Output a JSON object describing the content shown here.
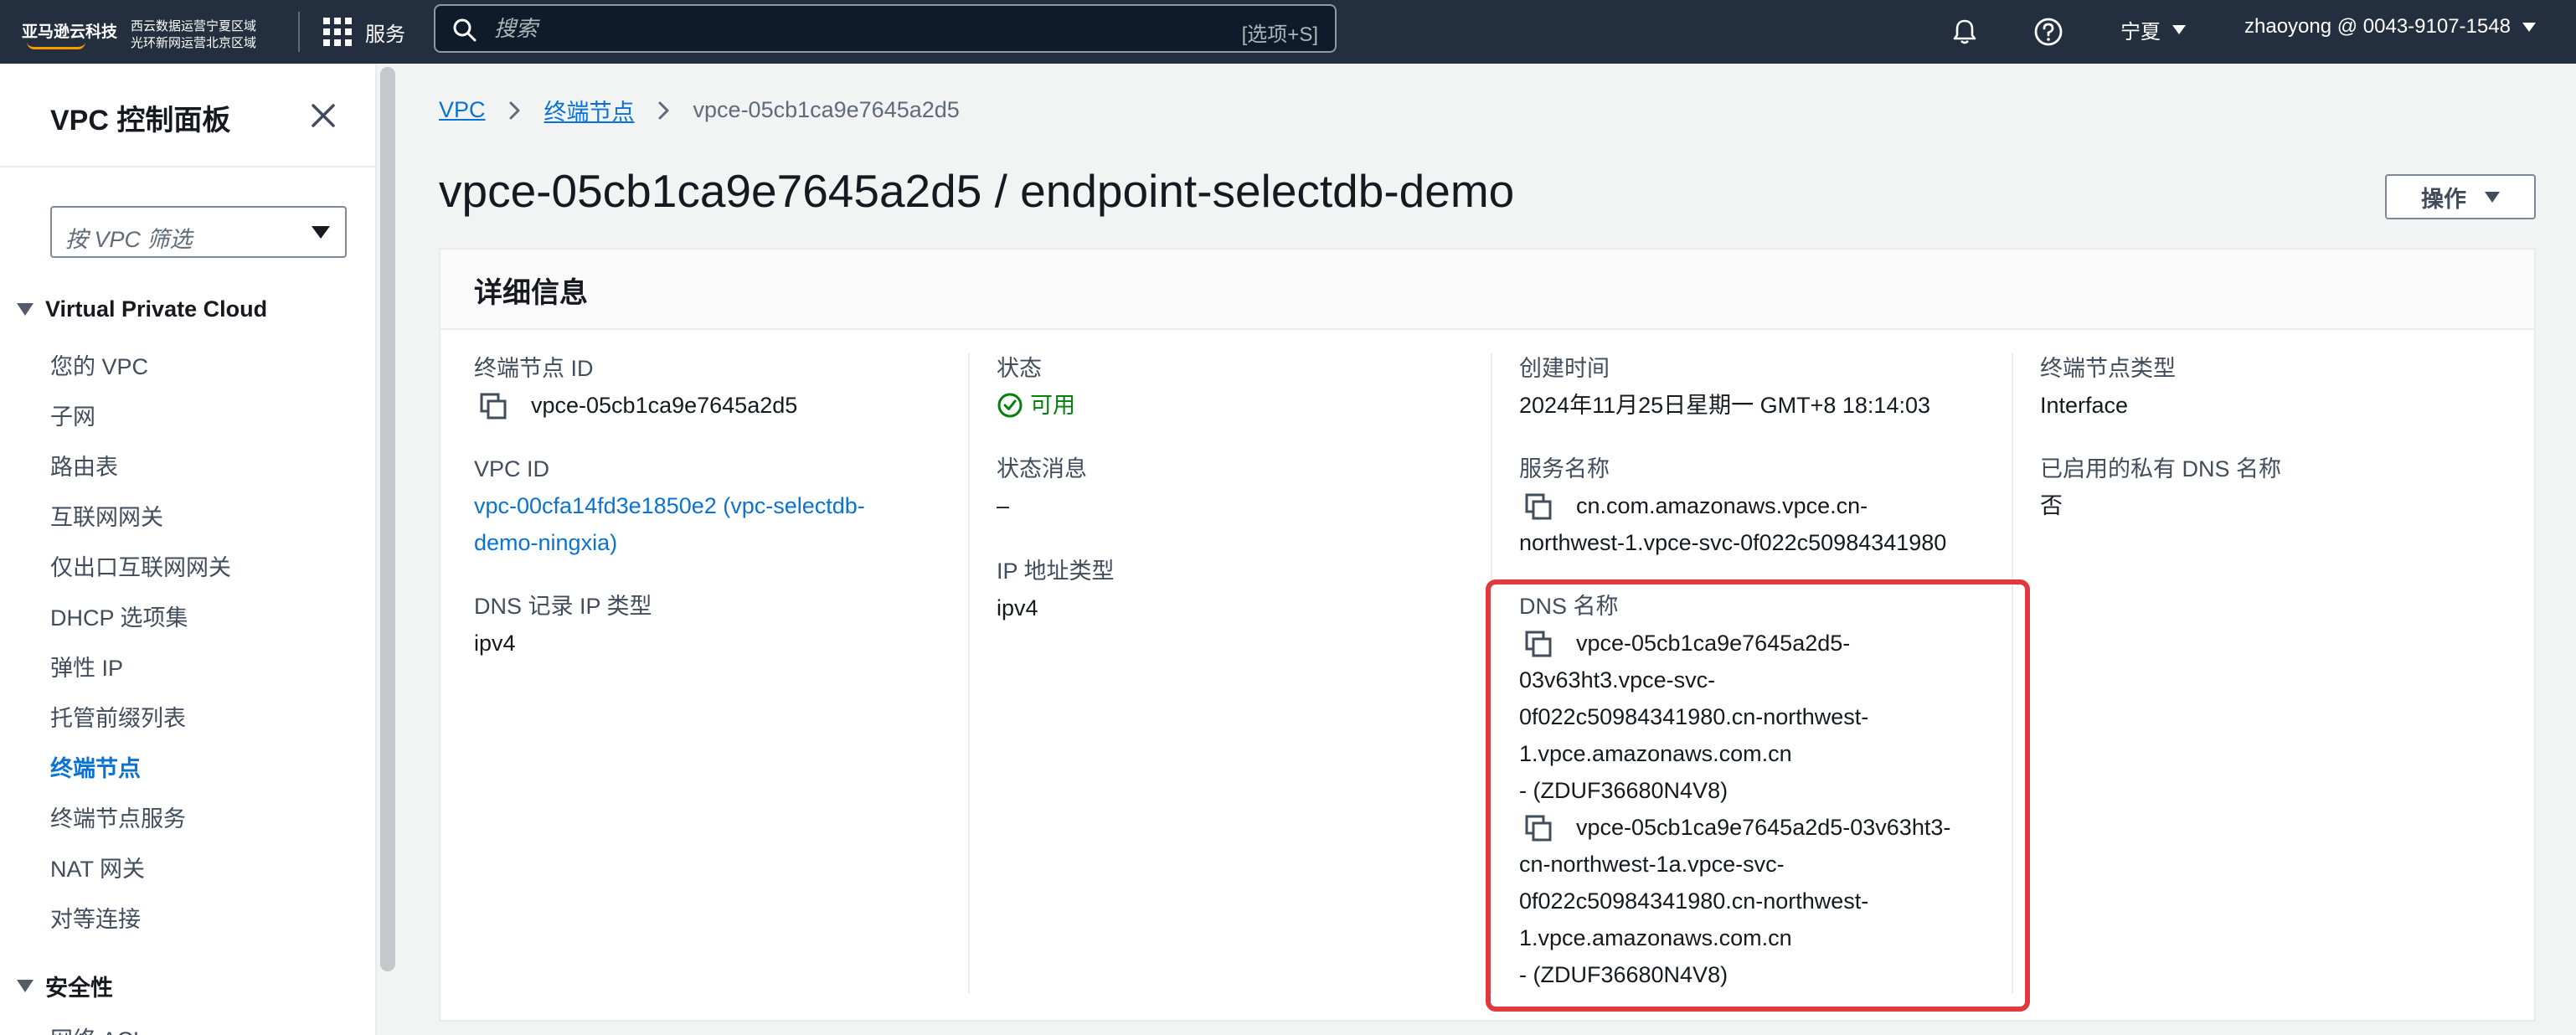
{
  "topnav": {
    "logo_main": "亚马逊云科技",
    "logo_sub_line1": "西云数据运营宁夏区域",
    "logo_sub_line2": "光环新网运营北京区域",
    "services_label": "服务",
    "search_placeholder": "搜索",
    "search_shortcut": "[选项+S]",
    "region": "宁夏",
    "account": "zhaoyong @ 0043-9107-1548"
  },
  "sidebar": {
    "title": "VPC 控制面板",
    "filter_placeholder": "按 VPC 筛选",
    "section1": "Virtual Private Cloud",
    "items": [
      "您的 VPC",
      "子网",
      "路由表",
      "互联网网关",
      "仅出口互联网网关",
      "DHCP 选项集",
      "弹性 IP",
      "托管前缀列表",
      "终端节点",
      "终端节点服务",
      "NAT 网关",
      "对等连接"
    ],
    "active_item": "终端节点",
    "section2": "安全性",
    "cut_item": "网络 ACL"
  },
  "breadcrumb": {
    "root": "VPC",
    "parent": "终端节点",
    "current": "vpce-05cb1ca9e7645a2d5"
  },
  "page": {
    "title": "vpce-05cb1ca9e7645a2d5 / endpoint-selectdb-demo",
    "actions_label": "操作"
  },
  "details": {
    "header": "详细信息",
    "endpoint_id_label": "终端节点 ID",
    "endpoint_id": "vpce-05cb1ca9e7645a2d5",
    "vpc_id_label": "VPC ID",
    "vpc_id_line1": "vpc-00cfa14fd3e1850e2 (vpc-selectdb-",
    "vpc_id_line2": "demo-ningxia)",
    "dns_record_type_label": "DNS 记录 IP 类型",
    "dns_record_type": "ipv4",
    "status_label": "状态",
    "status": "可用",
    "status_message_label": "状态消息",
    "status_message": "–",
    "ip_type_label": "IP 地址类型",
    "ip_type": "ipv4",
    "created_label": "创建时间",
    "created": "2024年11月25日星期一 GMT+8 18:14:03",
    "service_name_label": "服务名称",
    "service_name_line1": "cn.com.amazonaws.vpce.cn-",
    "service_name_line2": "northwest-1.vpce-svc-0f022c50984341980",
    "dns_names_label": "DNS 名称",
    "dns1": [
      "vpce-05cb1ca9e7645a2d5-",
      "03v63ht3.vpce-svc-",
      "0f022c50984341980.cn-northwest-",
      "1.vpce.amazonaws.com.cn",
      "- (ZDUF36680N4V8)"
    ],
    "dns2": [
      "vpce-05cb1ca9e7645a2d5-03v63ht3-",
      "cn-northwest-1a.vpce-svc-",
      "0f022c50984341980.cn-northwest-",
      "1.vpce.amazonaws.com.cn",
      "- (ZDUF36680N4V8)"
    ],
    "endpoint_type_label": "终端节点类型",
    "endpoint_type": "Interface",
    "private_dns_label": "已启用的私有 DNS 名称",
    "private_dns": "否"
  },
  "colors": {
    "nav_bg": "#232f3e",
    "link": "#0972d3",
    "success": "#037f0c",
    "highlight": "#e0393e"
  }
}
